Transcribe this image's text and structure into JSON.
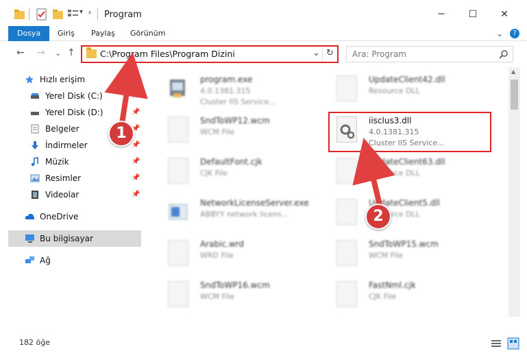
{
  "window": {
    "title": "Program",
    "minimize": "─",
    "maximize": "☐",
    "close": "✕"
  },
  "ribbon": {
    "tabs": [
      "Dosya",
      "Giriş",
      "Paylaş",
      "Görünüm"
    ],
    "expand": "⌄",
    "help": "?"
  },
  "nav": {
    "back": "←",
    "forward": "→",
    "recent": "⌄",
    "up": "↑"
  },
  "address": {
    "path": "C:\\Program Files\\Program Dizini",
    "dropdown": "⌄",
    "refresh": "↻"
  },
  "search": {
    "placeholder": "Ara: Program",
    "icon": "search-icon"
  },
  "sidebar": {
    "items": [
      {
        "label": "Hızlı erişim",
        "icon": "star-icon",
        "color": "#3a8ee6"
      },
      {
        "label": "Yerel Disk (C:)",
        "icon": "drive-icon",
        "color": "#5a5a5a",
        "pinned": true
      },
      {
        "label": "Yerel Disk (D:)",
        "icon": "drive-icon",
        "color": "#5a5a5a",
        "pinned": true
      },
      {
        "label": "Belgeler",
        "icon": "documents-icon",
        "color": "#7a8a99",
        "pinned": true
      },
      {
        "label": "İndirmeler",
        "icon": "download-icon",
        "color": "#2b74c9",
        "pinned": true
      },
      {
        "label": "Müzik",
        "icon": "music-icon",
        "color": "#2b74c9",
        "pinned": true
      },
      {
        "label": "Resimler",
        "icon": "pictures-icon",
        "color": "#5a8fc7",
        "pinned": true
      },
      {
        "label": "Videolar",
        "icon": "videos-icon",
        "color": "#444",
        "pinned": true
      },
      {
        "label": "OneDrive",
        "icon": "cloud-icon",
        "color": "#1c6fd1"
      },
      {
        "label": "Bu bilgisayar",
        "icon": "computer-icon",
        "color": "#3a8ee6",
        "selected": true
      },
      {
        "label": "Ağ",
        "icon": "network-icon",
        "color": "#3a8ee6"
      }
    ]
  },
  "files": [
    {
      "name": "program.exe",
      "version": "4.0.1381.315",
      "desc": "Cluster IIS Service...",
      "blurred": true
    },
    {
      "name": "UpdateClient42.dll",
      "version": "",
      "desc": "Resource DLL",
      "blurred": true
    },
    {
      "name": "SndToWP12.wcm",
      "version": "",
      "desc": "WCM File",
      "blurred": true
    },
    {
      "name": "iisclus3.dll",
      "version": "4.0.1381.315",
      "desc": "Cluster IIS Service...",
      "blurred": false
    },
    {
      "name": "DefaultFont.cjk",
      "version": "",
      "desc": "CJK File",
      "blurred": true
    },
    {
      "name": "UpdateClient63.dll",
      "version": "",
      "desc": "Resource DLL",
      "blurred": true
    },
    {
      "name": "NetworkLicenseServer.exe",
      "version": "",
      "desc": "ABBYY network licens...",
      "blurred": true
    },
    {
      "name": "UpdateClient5.dll",
      "version": "",
      "desc": "Resource DLL",
      "blurred": true
    },
    {
      "name": "Arabic.wrd",
      "version": "",
      "desc": "WRD File",
      "blurred": true
    },
    {
      "name": "SndToWP15.wcm",
      "version": "",
      "desc": "WCM File",
      "blurred": true
    },
    {
      "name": "SndToWP16.wcm",
      "version": "",
      "desc": "WCM File",
      "blurred": true
    },
    {
      "name": "FastNml.cjk",
      "version": "",
      "desc": "CJK File",
      "blurred": true
    }
  ],
  "annotations": {
    "step1": "1",
    "step2": "2"
  },
  "status": {
    "count": "182 öğe"
  },
  "colors": {
    "accent": "#1979ca",
    "highlight": "#e02424",
    "badge": "#d33a3a"
  }
}
